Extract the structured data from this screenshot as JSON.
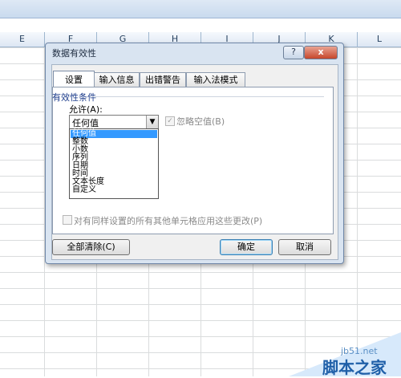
{
  "columns": [
    "E",
    "F",
    "G",
    "H",
    "I",
    "J",
    "K",
    "L"
  ],
  "dialog": {
    "title": "数据有效性",
    "help_glyph": "?",
    "close_glyph": "x",
    "tabs": [
      "设置",
      "输入信息",
      "出错警告",
      "输入法模式"
    ],
    "active_tab": "设置",
    "group_label": "有效性条件",
    "allow_label": "允许(A):",
    "combo_value": "任何值",
    "combo_arrow": "▼",
    "dropdown_options": [
      "任何值",
      "整数",
      "小数",
      "序列",
      "日期",
      "时间",
      "文本长度",
      "自定义"
    ],
    "selected_option": "任何值",
    "ignore_blank_label": "忽略空值(B)",
    "ignore_blank_checked": true,
    "apply_all_label": "对有同样设置的所有其他单元格应用这些更改(P)",
    "apply_all_checked": false,
    "buttons": {
      "clear_all": "全部清除(C)",
      "ok": "确定",
      "cancel": "取消"
    }
  },
  "watermark": {
    "url": "jb51.net",
    "text": "脚本之家"
  },
  "colors": {
    "selection": "#3399ff",
    "dialog_bg": "#d9e4f1",
    "close_red": "#c6462b"
  }
}
